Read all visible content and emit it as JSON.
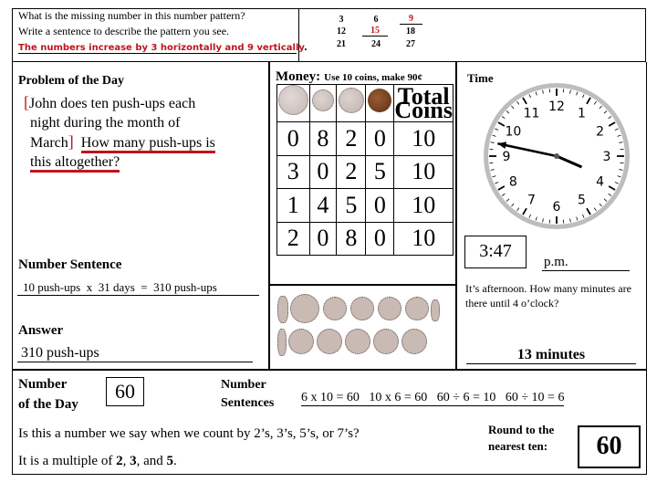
{
  "pattern": {
    "question_line1": "What is the missing number in this number pattern?",
    "question_line2": "Write a sentence to describe the pattern you see.",
    "answer": "The numbers increase by 3 horizontally and 9 vertically",
    "answer_period": ".",
    "grid": [
      [
        "3",
        "6",
        "9"
      ],
      [
        "12",
        "15",
        "18"
      ],
      [
        "21",
        "24",
        "27"
      ]
    ],
    "filled_cells": [
      "9",
      "15"
    ]
  },
  "problem": {
    "heading": "Problem of the Day",
    "bracket_open": "[",
    "bracket_close": "]",
    "line1": "John does ten push-ups each",
    "line2": "night during the month of",
    "line3_a": "March",
    "line3_b": "How many push-ups is",
    "line4": "this altogether?"
  },
  "number_sentence": {
    "heading": "Number Sentence",
    "value": "10 push-ups  x  31 days  =  310 push-ups"
  },
  "answer": {
    "heading": "Answer",
    "value": "310 push-ups"
  },
  "money": {
    "heading": "Money:",
    "instruction": "Use 10 coins, make 90¢",
    "coins": [
      "quarter",
      "dime",
      "nickel",
      "penny"
    ],
    "total_label_1": "Total",
    "total_label_2": "Coins",
    "rows": [
      [
        "0",
        "8",
        "2",
        "0",
        "10"
      ],
      [
        "3",
        "0",
        "2",
        "5",
        "10"
      ],
      [
        "1",
        "4",
        "5",
        "0",
        "10"
      ],
      [
        "2",
        "0",
        "8",
        "0",
        "10"
      ]
    ]
  },
  "time": {
    "heading": "Time",
    "clock_numbers": [
      "12",
      "1",
      "2",
      "3",
      "4",
      "5",
      "6",
      "7",
      "8",
      "9",
      "10",
      "11"
    ],
    "clock_hour": 3,
    "clock_minute": 47,
    "digital": "3:47",
    "meridiem": "p.m.",
    "question": "It’s afternoon. How many minutes are there until 4 o’clock?",
    "answer": "13 minutes"
  },
  "number_of_day": {
    "label_1": "Number",
    "label_2": "of the Day",
    "value": "60",
    "sentences_label_1": "Number",
    "sentences_label_2": "Sentences",
    "sentences": "6 x 10 = 60   10 x 6 = 60   60 ÷ 6 = 10   60 ÷ 10 = 6",
    "count_question": "Is this a number we say when we count by 2’s, 3’s, 5’s, or 7’s?",
    "multiple_prefix": "It is a multiple of ",
    "multiple_a": "2",
    "multiple_sep1": ", ",
    "multiple_b": "3",
    "multiple_sep2": ", and ",
    "multiple_c": "5",
    "multiple_end": ".",
    "round_label_1": "Round to the",
    "round_label_2": "nearest ten:",
    "round_value": "60"
  },
  "colors": {
    "accent_red": "#c0141b",
    "penny": "#7a4424",
    "silver_coin": "#d3c8c4"
  }
}
